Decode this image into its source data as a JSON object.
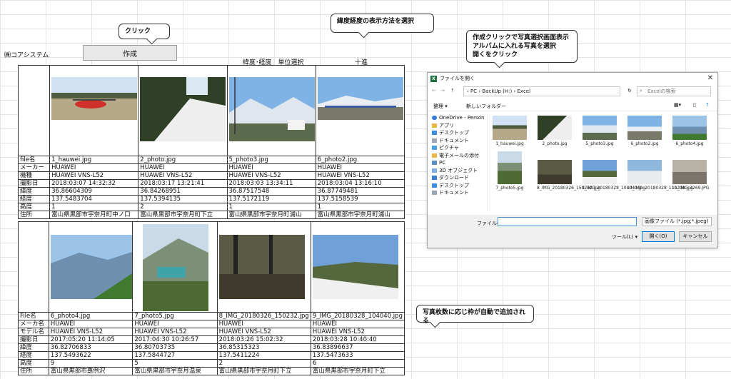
{
  "sheet": {
    "company": "㈱コアシステム",
    "create_button": "作成",
    "unit_select_label": "緯度･経度　単位選択",
    "unit_value": "十進"
  },
  "callouts": {
    "click": "クリック",
    "latlon": "緯度経度の表示方法を選択",
    "dialog_note_1": "作成クリックで写真選択画面表示",
    "dialog_note_2": "アルバムに入れる写真を選択",
    "dialog_note_3": "開くをクリック",
    "auto_add": "写真枚数に応じ枠が自動で追加される"
  },
  "table1": {
    "labels": [
      "file名",
      "メーカー",
      "機種",
      "撮影日",
      "緯度",
      "経度",
      "高度",
      "住所"
    ],
    "columns": [
      [
        "1_hauwei.jpg",
        "HUAWEI",
        "HUAWEI VNS-L52",
        "2018:03:07 14:32:32",
        "36.86604309",
        "137.5483704",
        "1",
        "富山県黒部市宇奈月町中ノ口"
      ],
      [
        "2_photo.jpg",
        "HUAWEI",
        "HUAWEI VNS-L52",
        "2018:03:17 13:21:41",
        "36.84268951",
        "137.5394135",
        "2",
        "富山県黒部市宇奈月町下立"
      ],
      [
        "5_photo3.jpg",
        "HUAWEI",
        "HUAWEI VNS-L52",
        "2018:03:03 13:34:11",
        "36.87517548",
        "137.5172119",
        "1",
        "富山県黒部市宇奈月町浦山"
      ],
      [
        "6_photo2.jpg",
        "HUAWEI",
        "HUAWEI VNS-L52",
        "2018:03:04 13:16:10",
        "36.87749481",
        "137.5158539",
        "1",
        "富山県黒部市宇奈月町浦山"
      ]
    ]
  },
  "table2": {
    "labels": [
      "File名",
      "メーカ名",
      "モデル名",
      "撮影日",
      "緯度",
      "経度",
      "高度",
      "住所"
    ],
    "columns": [
      [
        "6_photo4.jpg",
        "HUAWEI",
        "HUAWEI VNS-L52",
        "2017:05:20 11:14:05",
        "36.82706833",
        "137.5493622",
        "9",
        "富山県黒部市嘉例沢"
      ],
      [
        "7_photo5.jpg",
        "HUAWEI",
        "HUAWEI VNS-L52",
        "2017:04:30 10:26:57",
        "36.80703735",
        "137.5844727",
        "5",
        "富山県黒部市宇奈月温泉"
      ],
      [
        "8_IMG_20180326_150232.jpg",
        "HUAWEI",
        "HUAWEI VNS-L52",
        "2018:03:26 15:02:32",
        "36.85315323",
        "137.5411224",
        "2",
        "富山県黒部市宇奈月町下立"
      ],
      [
        "9_IMG_20180328_104040.jpg",
        "HUAWEI",
        "HUAWEI VNS-L52",
        "2018:03:28 10:40:40",
        "36.83896637",
        "137.5473633",
        "6",
        "富山県黒部市宇奈月町下立"
      ]
    ]
  },
  "dialog": {
    "title": "ファイルを開く",
    "path": "›  PC  ›  BackUp (H:)  ›  Excel",
    "search_placeholder": "Excelの検索",
    "organize": "整理 ▾",
    "new_folder": "新しいフォルダー",
    "nav_items": [
      "OneDrive - Person",
      "アプリ",
      "デスクトップ",
      "ドキュメント",
      "ピクチャ",
      "電子メールの添付",
      "PC",
      "3D オブジェクト",
      "ダウンロード",
      "デスクトップ",
      "ドキュメント"
    ],
    "files": [
      "1_hauwei.jpg",
      "2_photo.jpg",
      "5_photo3.jpg",
      "6_photo2.jpg",
      "6_photo4.jpg",
      "7_photo5.jpg",
      "8_IMG_20180326_150232.jpg",
      "9_IMG_20180328_104040.jpg",
      "10_IMG_20180328_110208.jpg",
      "11_IMG_1269.JPG"
    ],
    "filename_label": "ファイル名(N):",
    "filetype": "画像ファイル (*.jpg;*.jpeg)",
    "tools": "ツール(L) ▾",
    "open": "開く(O)",
    "cancel": "キャンセル"
  },
  "colors": {
    "sky": "#7fb3e6",
    "snow": "#f2f2f2",
    "excel_green": "#1d6f42",
    "accent_blue": "#0078d7"
  }
}
